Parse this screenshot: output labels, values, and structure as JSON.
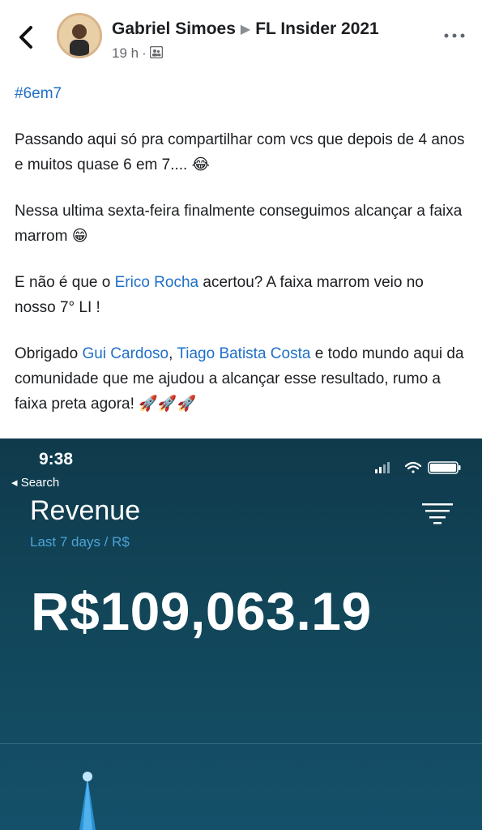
{
  "header": {
    "author": "Gabriel Simoes",
    "group": "FL Insider 2021",
    "time_ago": "19 h",
    "separator": "·"
  },
  "icons": {
    "back": "chevron-left-icon",
    "more": "more-horizontal-icon",
    "audience": "group-icon",
    "wifi": "wifi-icon",
    "battery": "battery-icon",
    "signal": "signal-icon",
    "menu": "filter-lines-icon"
  },
  "post": {
    "hashtag": "#6em7",
    "p1": "Passando aqui só pra compartilhar com vcs que depois de 4 anos e muitos quase 6 em 7....",
    "p1_emoji": "😂",
    "p2": "Nessa ultima sexta-feira finalmente conseguimos alcançar a faixa marrom",
    "p2_emoji": "😁",
    "p3_a": "E não é que o ",
    "p3_mention": "Erico Rocha",
    "p3_b": " acertou? A faixa marrom veio no nosso 7° LI !",
    "p4_a": "Obrigado ",
    "p4_mention1": "Gui Cardoso",
    "p4_comma": ", ",
    "p4_mention2": "Tiago Batista Costa",
    "p4_b": " e todo mundo aqui da comunidade que me ajudou a alcançar esse resultado, rumo a faixa preta agora!",
    "p4_emoji": "🚀🚀🚀"
  },
  "screenshot": {
    "clock": "9:38",
    "back_label": "◂ Search",
    "title": "Revenue",
    "subtitle": "Last 7 days / R$",
    "amount": "R$109,063.19"
  },
  "colors": {
    "link": "#1f6fc7",
    "panel_bg": "#124659",
    "accent": "#4da3d9"
  }
}
